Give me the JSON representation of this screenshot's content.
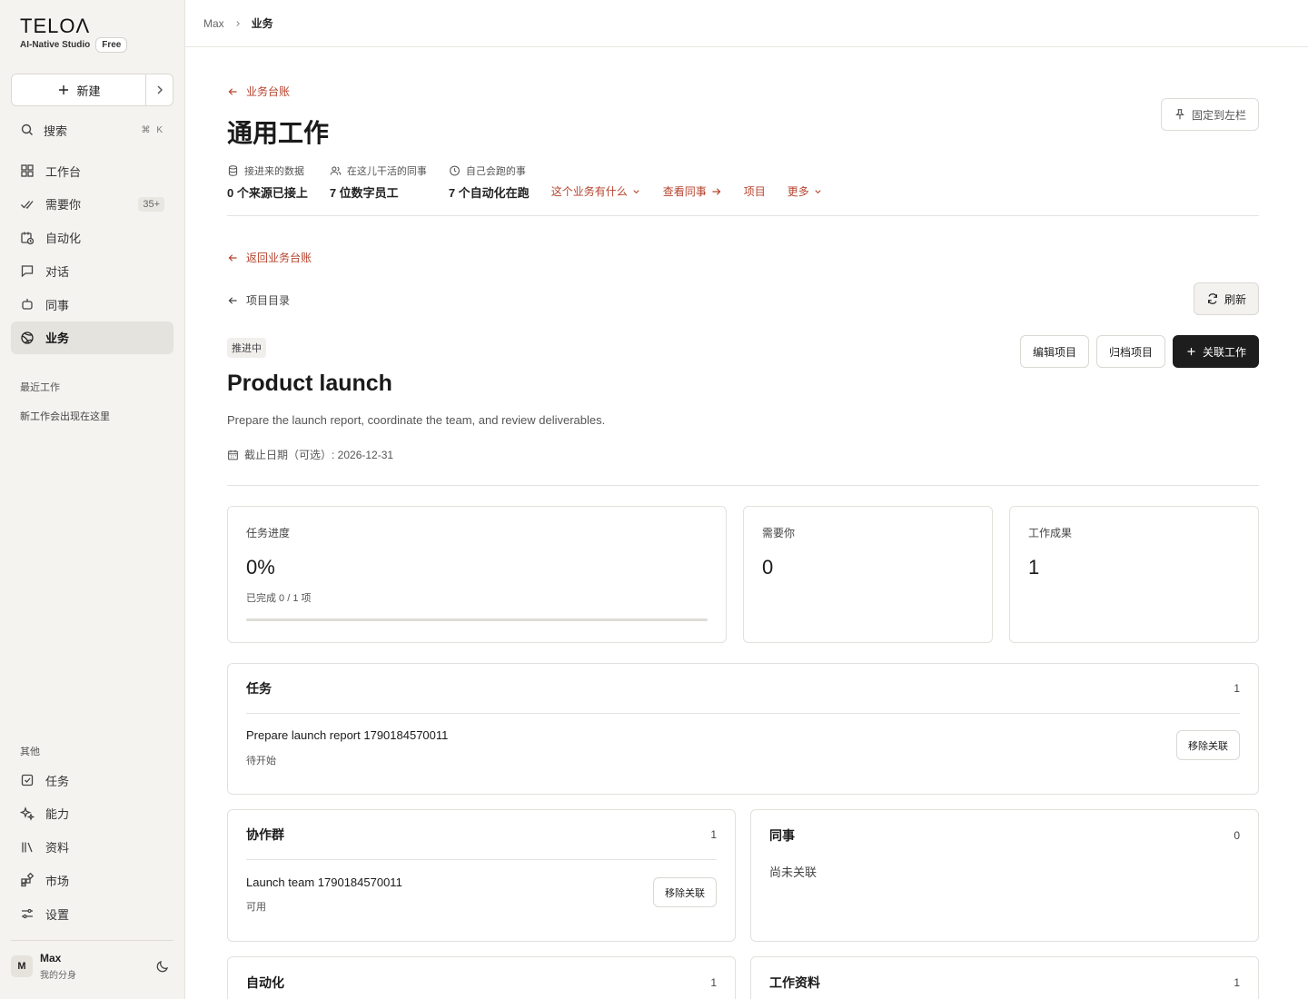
{
  "brand": {
    "logo": "TELOΛ",
    "subtitle": "AI-Native Studio",
    "plan": "Free"
  },
  "sidebar": {
    "new_label": "新建",
    "search_label": "搜索",
    "search_shortcut": "⌘ K",
    "nav": [
      {
        "label": "工作台",
        "icon": "grid-icon"
      },
      {
        "label": "需要你",
        "icon": "double-check-icon",
        "count": "35+"
      },
      {
        "label": "自动化",
        "icon": "calendar-clock-icon"
      },
      {
        "label": "对话",
        "icon": "chat-icon"
      },
      {
        "label": "同事",
        "icon": "bot-icon"
      },
      {
        "label": "业务",
        "icon": "globe-icon",
        "active": true
      }
    ],
    "recent_label": "最近工作",
    "recent_empty": "新工作会出现在这里",
    "other_label": "其他",
    "other_nav": [
      {
        "label": "任务",
        "icon": "checkbox-icon"
      },
      {
        "label": "能力",
        "icon": "sparkle-icon"
      },
      {
        "label": "资料",
        "icon": "library-icon"
      },
      {
        "label": "市场",
        "icon": "apps-icon"
      },
      {
        "label": "设置",
        "icon": "sliders-icon"
      }
    ],
    "user": {
      "initial": "M",
      "name": "Max",
      "sub": "我的分身"
    }
  },
  "breadcrumb": {
    "root": "Max",
    "current": "业务"
  },
  "header": {
    "back_label": "业务台账",
    "title": "通用工作",
    "pin_label": "固定到左栏",
    "meta": [
      {
        "label": "接进来的数据",
        "value": "0 个来源已接上",
        "icon": "database-icon"
      },
      {
        "label": "在这儿干活的同事",
        "value": "7 位数字员工",
        "icon": "users-icon"
      },
      {
        "label": "自己会跑的事",
        "value": "7 个自动化在跑",
        "icon": "clock-icon"
      }
    ],
    "links": {
      "what": "这个业务有什么",
      "colleagues": "查看同事",
      "projects": "项目",
      "more": "更多"
    }
  },
  "project": {
    "back_ledger": "返回业务台账",
    "back_catalog": "项目目录",
    "refresh": "刷新",
    "status": "推进中",
    "edit": "编辑项目",
    "archive": "归档项目",
    "link_work": "关联工作",
    "title": "Product launch",
    "description": "Prepare the launch report, coordinate the team, and review deliverables.",
    "due": "截止日期（可选）: 2026-12-31"
  },
  "stats": {
    "progress": {
      "label": "任务进度",
      "value": "0%",
      "sub": "已完成 0 / 1 项",
      "fraction": 0
    },
    "needs_you": {
      "label": "需要你",
      "value": "0"
    },
    "outputs": {
      "label": "工作成果",
      "value": "1"
    }
  },
  "tasks_panel": {
    "title": "任务",
    "count": "1",
    "items": [
      {
        "title": "Prepare launch report 1790184570011",
        "status": "待开始",
        "action": "移除关联"
      }
    ]
  },
  "groups_panel": {
    "title": "协作群",
    "count": "1",
    "items": [
      {
        "title": "Launch team 1790184570011",
        "status": "可用",
        "action": "移除关联"
      }
    ]
  },
  "colleagues_panel": {
    "title": "同事",
    "count": "0",
    "empty": "尚未关联"
  },
  "automation_panel": {
    "title": "自动化",
    "count": "1"
  },
  "materials_panel": {
    "title": "工作资料",
    "count": "1"
  }
}
